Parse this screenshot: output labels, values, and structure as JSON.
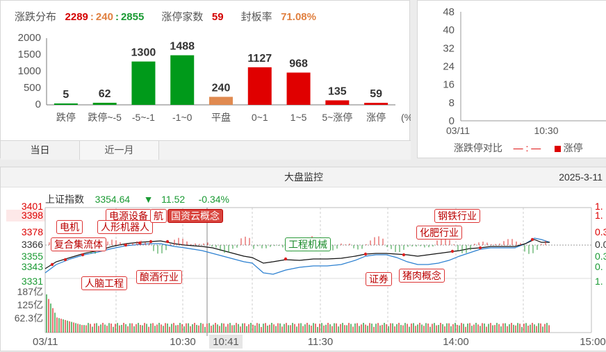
{
  "distribution": {
    "label_dist": "涨跌分布",
    "up": "2289",
    "flat": "240",
    "down": "2855",
    "label_limit_up_count": "涨停家数",
    "limit_up_count": "59",
    "label_seal_rate": "封板率",
    "seal_rate": "71.08%",
    "tabs": [
      "当日",
      "近一月"
    ],
    "unit_label": "(%)",
    "colors": {
      "red": "#e00000",
      "green": "#009a1a",
      "orange": "#e08a50"
    }
  },
  "chart_data": [
    {
      "type": "bar",
      "title": "",
      "categories": [
        "跌停",
        "跌停~-5",
        "-5~-1",
        "-1~0",
        "平盘",
        "0~1",
        "1~5",
        "5~涨停",
        "涨停"
      ],
      "values": [
        5,
        62,
        1300,
        1488,
        240,
        1127,
        968,
        135,
        59
      ],
      "value_labels": [
        "5",
        "62",
        "1300",
        "1488",
        "240",
        "1127",
        "968",
        "135",
        "59"
      ],
      "bar_colors": [
        "#009a1a",
        "#009a1a",
        "#009a1a",
        "#009a1a",
        "#e08a50",
        "#e00000",
        "#e00000",
        "#e00000",
        "#e00000"
      ],
      "yticks": [
        "2000",
        "1500",
        "1000",
        "500",
        "0"
      ],
      "ylim": [
        0,
        2000
      ],
      "grid": false
    },
    {
      "type": "line",
      "title": "",
      "yticks": [
        "48",
        "40",
        "32",
        "24",
        "16",
        "8",
        "0"
      ],
      "ylim": [
        0,
        48
      ],
      "xticks": [
        "03/11",
        "10:30"
      ],
      "legend": [
        "涨跌停对比",
        "— : —",
        "涨停"
      ],
      "series": []
    }
  ],
  "monitor": {
    "title": "大盘监控",
    "date": "2025-3-11",
    "index_name": "上证指数",
    "index_value": "3354.64",
    "change_arrow": "▼",
    "change": "11.52",
    "change_pct": "-0.34%",
    "y_left": [
      "3401",
      "3398",
      "3378",
      "3366",
      "3355",
      "3343",
      "3331"
    ],
    "y_right": [
      "1.",
      "1.",
      "0.3",
      "0.0",
      "0.3",
      "0.",
      "1."
    ],
    "vol_labels": [
      "187亿",
      "125亿",
      "62.3亿"
    ],
    "x_labels": [
      "03/11",
      "10:30",
      "10:41",
      "11:30",
      "14:00",
      "15:00"
    ],
    "tags": [
      {
        "text": "电机",
        "style": "red"
      },
      {
        "text": "复合集流体",
        "style": "red"
      },
      {
        "text": "电源设备",
        "style": "red"
      },
      {
        "text": "人形机器人",
        "style": "red"
      },
      {
        "text": "航",
        "style": "red"
      },
      {
        "text": "国资云概念",
        "style": "filled"
      },
      {
        "text": "人脑工程",
        "style": "red"
      },
      {
        "text": "酿酒行业",
        "style": "red"
      },
      {
        "text": "工程机械",
        "style": "green"
      },
      {
        "text": "证券",
        "style": "red"
      },
      {
        "text": "猪肉概念",
        "style": "red"
      },
      {
        "text": "化肥行业",
        "style": "red"
      },
      {
        "text": "钢铁行业",
        "style": "red"
      }
    ]
  },
  "ratio_panel": {
    "legend_title": "涨跌停对比",
    "legend_dash": "— : —",
    "legend_up": "涨停"
  }
}
